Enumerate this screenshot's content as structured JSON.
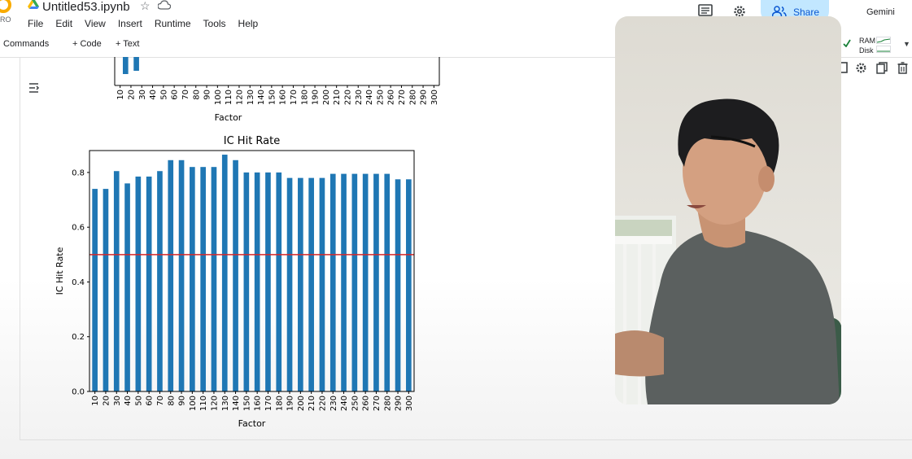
{
  "app": {
    "logo_sub": "RO",
    "title": "Untitled53.ipynb",
    "menu": [
      "File",
      "Edit",
      "View",
      "Insert",
      "Runtime",
      "Tools",
      "Help"
    ],
    "share_label": "Share",
    "gemini_label": "Gemini"
  },
  "toolbar": {
    "commands_label": "Commands",
    "code_label": "+ Code",
    "text_label": "+ Text",
    "ram_label": "RAM",
    "disk_label": "Disk"
  },
  "colors": {
    "bar": "#1f77b4",
    "ref_line": "#d62728",
    "share_bg": "#c2e7ff",
    "accent": "#0b57d0"
  },
  "chart_data": [
    {
      "type": "bar",
      "partial": true,
      "xlabel": "Factor",
      "categories": [
        "10",
        "20",
        "30",
        "40",
        "50",
        "60",
        "70",
        "80",
        "90",
        "100",
        "110",
        "120",
        "130",
        "140",
        "150",
        "160",
        "170",
        "180",
        "190",
        "200",
        "210",
        "220",
        "230",
        "240",
        "250",
        "260",
        "270",
        "280",
        "290",
        "300"
      ]
    },
    {
      "type": "bar",
      "title": "IC Hit Rate",
      "xlabel": "Factor",
      "ylabel": "IC Hit Rate",
      "ylim": [
        0.0,
        0.88
      ],
      "yticks": [
        "0.0",
        "0.2",
        "0.4",
        "0.6",
        "0.8"
      ],
      "categories": [
        "10",
        "20",
        "30",
        "40",
        "50",
        "60",
        "70",
        "80",
        "90",
        "100",
        "110",
        "120",
        "130",
        "140",
        "150",
        "160",
        "170",
        "180",
        "190",
        "200",
        "210",
        "220",
        "230",
        "240",
        "250",
        "260",
        "270",
        "280",
        "290",
        "300"
      ],
      "values": [
        0.74,
        0.74,
        0.805,
        0.76,
        0.785,
        0.785,
        0.805,
        0.845,
        0.845,
        0.82,
        0.82,
        0.82,
        0.865,
        0.845,
        0.8,
        0.8,
        0.8,
        0.8,
        0.78,
        0.78,
        0.78,
        0.78,
        0.795,
        0.795,
        0.795,
        0.795,
        0.795,
        0.795,
        0.775,
        0.775
      ],
      "reference_line": 0.5,
      "grid": false
    }
  ]
}
